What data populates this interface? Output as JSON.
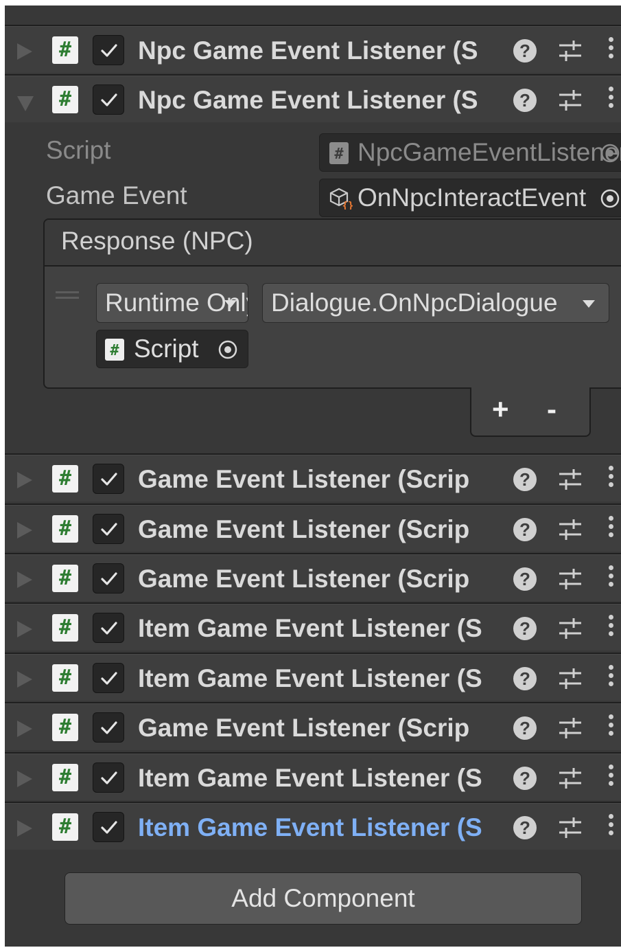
{
  "components": [
    {
      "title": "Npc Game Event Listener (S",
      "expanded": false,
      "enabled": true,
      "selected": false
    },
    {
      "title": "Npc Game Event Listener (S",
      "expanded": true,
      "enabled": true,
      "selected": false
    },
    {
      "title": "Game Event Listener (Scrip",
      "expanded": false,
      "enabled": true,
      "selected": false
    },
    {
      "title": "Game Event Listener (Scrip",
      "expanded": false,
      "enabled": true,
      "selected": false
    },
    {
      "title": "Game Event Listener (Scrip",
      "expanded": false,
      "enabled": true,
      "selected": false
    },
    {
      "title": "Item Game Event Listener (S",
      "expanded": false,
      "enabled": true,
      "selected": false
    },
    {
      "title": "Item Game Event Listener (S",
      "expanded": false,
      "enabled": true,
      "selected": false
    },
    {
      "title": "Game Event Listener (Scrip",
      "expanded": false,
      "enabled": true,
      "selected": false
    },
    {
      "title": "Item Game Event Listener (S",
      "expanded": false,
      "enabled": true,
      "selected": false
    },
    {
      "title": "Item Game Event Listener (S",
      "expanded": false,
      "enabled": true,
      "selected": true
    }
  ],
  "icons": {
    "component": "hash-script-icon",
    "help": "help-icon",
    "presets": "presets-sliders-icon",
    "menu": "vertical-ellipsis-icon"
  },
  "expanded_component": {
    "script_label": "Script",
    "script_value": "NpcGameEventListener",
    "game_event_label": "Game Event",
    "game_event_value": "OnNpcInteractEvent",
    "response_header": "Response (NPC)",
    "response": {
      "runtime_option": "Runtime Only",
      "function": "Dialogue.OnNpcDialogue",
      "target_value": "Script"
    },
    "add_label": "+",
    "remove_label": "-"
  },
  "add_component_label": "Add Component",
  "colors": {
    "selected_title": "#7fb0f5",
    "script_hash": "#2e7d32",
    "panel_bg": "#383838"
  }
}
